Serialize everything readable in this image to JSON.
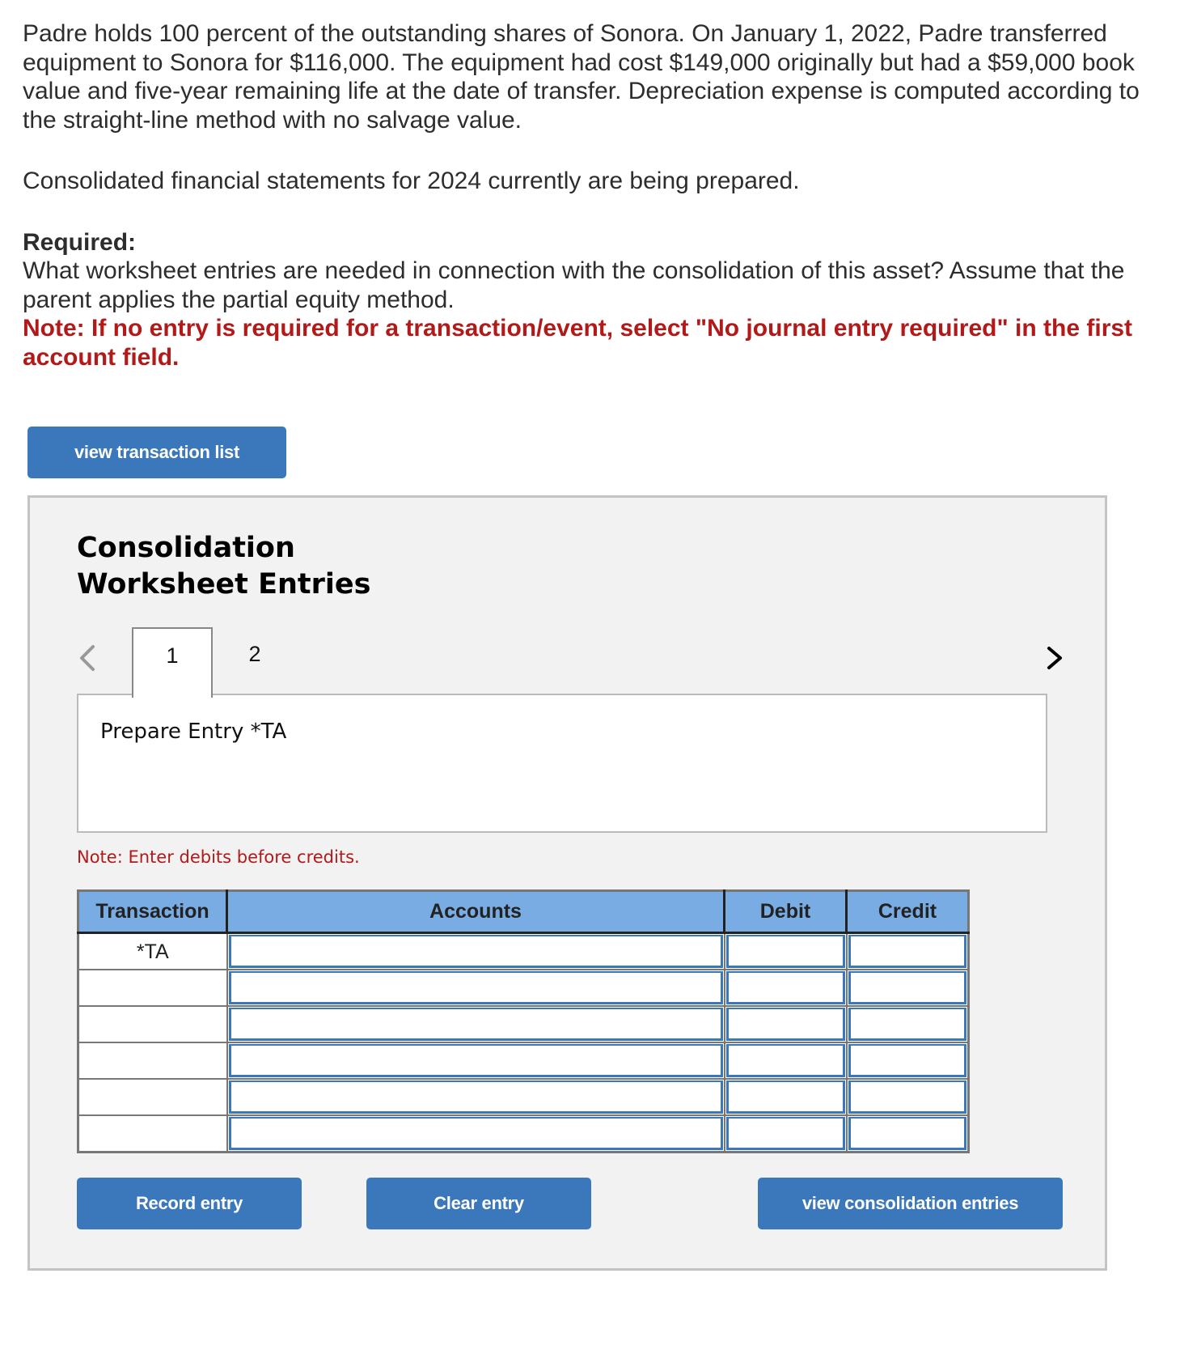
{
  "problem": {
    "paragraph1": "Padre holds 100 percent of the outstanding shares of Sonora. On January 1, 2022, Padre transferred equipment to Sonora for $116,000. The equipment had cost $149,000 originally but had a $59,000 book value and five-year remaining life at the date of transfer. Depreciation expense is computed according to the straight-line method with no salvage value.",
    "paragraph2": "Consolidated financial statements for 2024 currently are being prepared.",
    "required_label": "Required:",
    "required_text": "What worksheet entries are needed in connection with the consolidation of this asset? Assume that the parent applies the partial equity method.",
    "note": "Note: If no entry is required for a transaction/event, select \"No journal entry required\" in the first account field."
  },
  "buttons": {
    "view_transaction_list": "view transaction list",
    "record_entry": "Record entry",
    "clear_entry": "Clear entry",
    "view_consolidation_entries": "view consolidation entries"
  },
  "panel": {
    "title_line1": "Consolidation",
    "title_line2": "Worksheet Entries",
    "tabs": [
      {
        "label": "1",
        "active": true
      },
      {
        "label": "2",
        "active": false
      }
    ],
    "prev_icon": "chevron-left-icon",
    "next_icon": "chevron-right-icon",
    "prompt": "Prepare Entry *TA",
    "debit_note": "Note: Enter debits before credits."
  },
  "table": {
    "columns": [
      "Transaction",
      "Accounts",
      "Debit",
      "Credit"
    ],
    "rows": [
      {
        "transaction": "*TA",
        "account": "",
        "debit": "",
        "credit": ""
      },
      {
        "transaction": "",
        "account": "",
        "debit": "",
        "credit": ""
      },
      {
        "transaction": "",
        "account": "",
        "debit": "",
        "credit": ""
      },
      {
        "transaction": "",
        "account": "",
        "debit": "",
        "credit": ""
      },
      {
        "transaction": "",
        "account": "",
        "debit": "",
        "credit": ""
      },
      {
        "transaction": "",
        "account": "",
        "debit": "",
        "credit": ""
      }
    ]
  },
  "colors": {
    "button_blue": "#3a77bb",
    "header_blue": "#79ace3",
    "note_red": "#b21a1a",
    "panel_bg": "#f2f2f2"
  }
}
